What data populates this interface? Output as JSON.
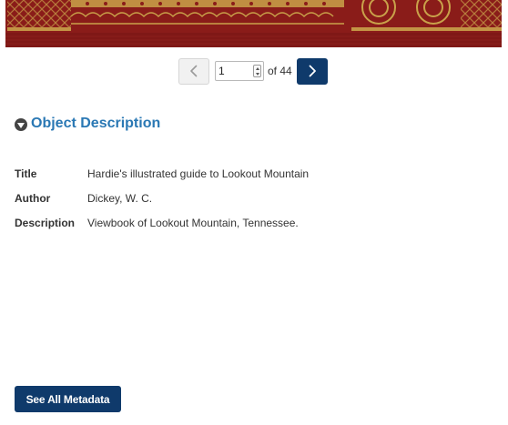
{
  "viewer": {
    "cover_alt": "Book cover image (decorative pattern)"
  },
  "pager": {
    "prev_icon": "chevron-left-icon",
    "next_icon": "chevron-right-icon",
    "current_page": "1",
    "of_label": "of 44",
    "total_pages": 44
  },
  "description": {
    "heading": "Object Description",
    "heading_icon": "collapse-down-circle-icon",
    "rows": [
      {
        "label": "Title",
        "value": "Hardie's illustrated guide to Lookout Mountain"
      },
      {
        "label": "Author",
        "value": "Dickey, W. C."
      },
      {
        "label": "Description",
        "value": "Viewbook of Lookout Mountain, Tennessee."
      }
    ]
  },
  "actions": {
    "see_all_label": "See All Metadata"
  },
  "colors": {
    "accent_blue": "#2a78b4",
    "button_navy": "#0f3a6b",
    "cover_red": "#8c1d1a",
    "cover_gold": "#c9a24a"
  }
}
